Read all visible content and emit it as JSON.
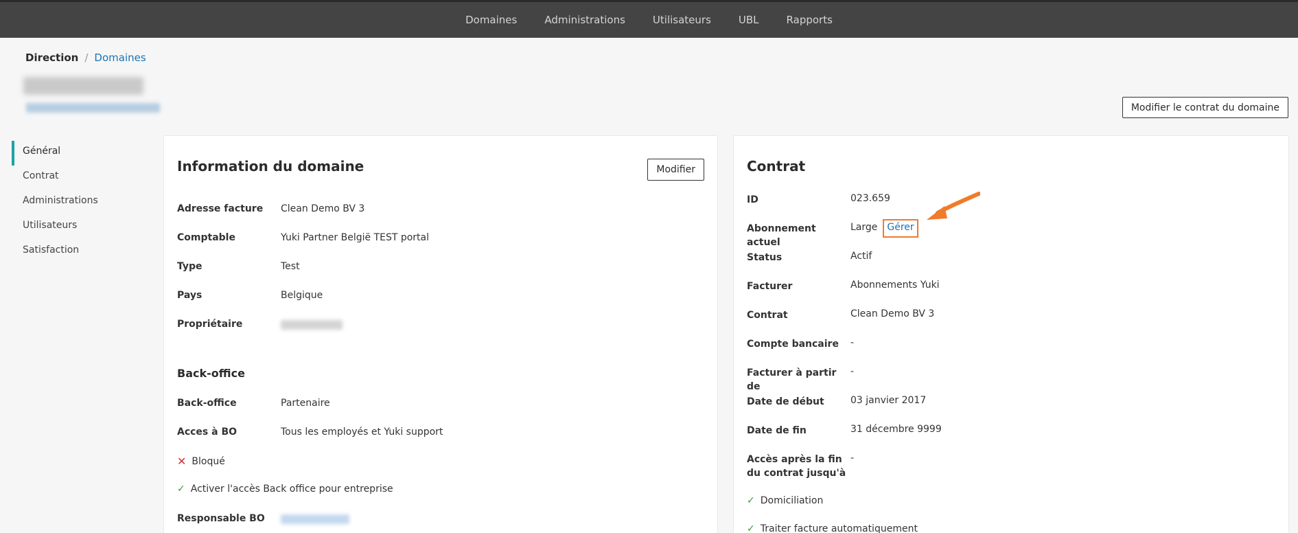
{
  "topnav": {
    "items": [
      {
        "label": "Domaines"
      },
      {
        "label": "Administrations"
      },
      {
        "label": "Utilisateurs"
      },
      {
        "label": "UBL"
      },
      {
        "label": "Rapports"
      }
    ]
  },
  "breadcrumb": {
    "root": "Direction",
    "separator": "/",
    "current": "Domaines"
  },
  "header": {
    "edit_contract_label": "Modifier le contrat du domaine"
  },
  "sidenav": {
    "items": [
      {
        "label": "Général"
      },
      {
        "label": "Contrat"
      },
      {
        "label": "Administrations"
      },
      {
        "label": "Utilisateurs"
      },
      {
        "label": "Satisfaction"
      }
    ]
  },
  "domain_info": {
    "title": "Information du domaine",
    "edit_label": "Modifier",
    "rows": [
      {
        "label": "Adresse facture",
        "value": "Clean Demo BV 3"
      },
      {
        "label": "Comptable",
        "value": "Yuki Partner België TEST portal"
      },
      {
        "label": "Type",
        "value": "Test"
      },
      {
        "label": "Pays",
        "value": "Belgique"
      },
      {
        "label": "Propriétaire",
        "value": ""
      }
    ],
    "backoffice_title": "Back-office",
    "backoffice_rows": [
      {
        "label": "Back-office",
        "value": "Partenaire"
      },
      {
        "label": "Acces à BO",
        "value": "Tous les employés et Yuki support"
      }
    ],
    "blocked_label": "Bloqué",
    "activate_label": "Activer l'accès Back office pour entreprise",
    "responsable_label": "Responsable BO"
  },
  "contract": {
    "title": "Contrat",
    "rows": [
      {
        "label": "ID",
        "value": "023.659"
      },
      {
        "label": "Abonnement actuel",
        "value": "Large",
        "link": "Gérer"
      },
      {
        "label": "Status",
        "value": "Actif"
      },
      {
        "label": "Facturer",
        "value": "Abonnements Yuki"
      },
      {
        "label": "Contrat",
        "value": "Clean Demo BV 3"
      },
      {
        "label": "Compte bancaire",
        "value": "-"
      },
      {
        "label": "Facturer à partir de",
        "value": "-"
      },
      {
        "label": "Date de début",
        "value": "03 janvier 2017"
      },
      {
        "label": "Date de fin",
        "value": "31 décembre 9999"
      },
      {
        "label": "Accès après la fin du contrat jusqu'à",
        "value": "-"
      }
    ],
    "checks": [
      {
        "label": "Domiciliation"
      },
      {
        "label": "Traiter facture automatiquement"
      }
    ]
  },
  "colors": {
    "accent": "#1ba3a6",
    "link": "#1a73b8",
    "highlight": "#f07b2a",
    "nav_bg": "#444444"
  }
}
